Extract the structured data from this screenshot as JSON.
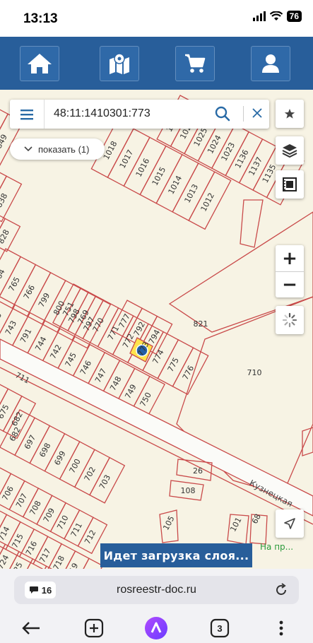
{
  "status_bar": {
    "time": "13:13",
    "battery": "76"
  },
  "nav": {
    "items": [
      {
        "icon": "home-icon"
      },
      {
        "icon": "map-pin-icon"
      },
      {
        "icon": "cart-icon"
      },
      {
        "icon": "user-icon"
      }
    ]
  },
  "search": {
    "value": "48:11:1410301:773"
  },
  "show_button": {
    "label": "показать (1)"
  },
  "map": {
    "parcel_labels": [
      "1018",
      "1017",
      "1016",
      "1015",
      "1014",
      "1013",
      "1012",
      "1027",
      "1026",
      "1025",
      "1024",
      "1023",
      "1136",
      "1137",
      "1135",
      "1138",
      "153",
      "849",
      "848",
      "838",
      "839",
      "827",
      "828",
      "764",
      "765",
      "766",
      "799",
      "800",
      "798",
      "797",
      "796",
      "743",
      "791",
      "744",
      "742",
      "745",
      "746",
      "747",
      "748",
      "749",
      "750",
      "751",
      "769",
      "770",
      "771",
      "772",
      "773",
      "774",
      "775",
      "776",
      "777",
      "792",
      "794",
      "821",
      "710",
      "711",
      "435",
      "675",
      "682",
      "697",
      "698",
      "699",
      "700",
      "702",
      "703",
      "704",
      "705",
      "706",
      "707",
      "708",
      "709",
      "710",
      "711",
      "712",
      "713",
      "714",
      "715",
      "716",
      "717",
      "718",
      "719",
      "720",
      "723",
      "724",
      "725",
      "736",
      "759",
      "298",
      "26",
      "108",
      "105",
      "101",
      "68"
    ],
    "street_label": "Кузнецкая"
  },
  "controls": {
    "zoom_in": "+",
    "zoom_out": "−"
  },
  "loading": {
    "text": "Идет загрузка слоя..."
  },
  "road_label": "На пр...",
  "browser": {
    "url": "rosreestr-doc.ru",
    "badge_count": "16",
    "tabs_count": "3"
  }
}
